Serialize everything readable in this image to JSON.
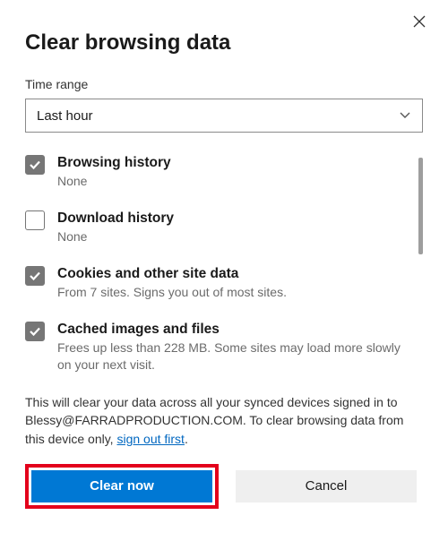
{
  "title": "Clear browsing data",
  "time_range": {
    "label": "Time range",
    "selected": "Last hour"
  },
  "options": [
    {
      "label": "Browsing history",
      "desc": "None",
      "checked": true
    },
    {
      "label": "Download history",
      "desc": "None",
      "checked": false
    },
    {
      "label": "Cookies and other site data",
      "desc": "From 7 sites. Signs you out of most sites.",
      "checked": true
    },
    {
      "label": "Cached images and files",
      "desc": "Frees up less than 228 MB. Some sites may load more slowly on your next visit.",
      "checked": true
    }
  ],
  "info": {
    "prefix": "This will clear your data across all your synced devices signed in to Blessy@FARRADPRODUCTION.COM. To clear browsing data from this device only, ",
    "link": "sign out first",
    "suffix": "."
  },
  "buttons": {
    "primary": "Clear now",
    "secondary": "Cancel"
  }
}
